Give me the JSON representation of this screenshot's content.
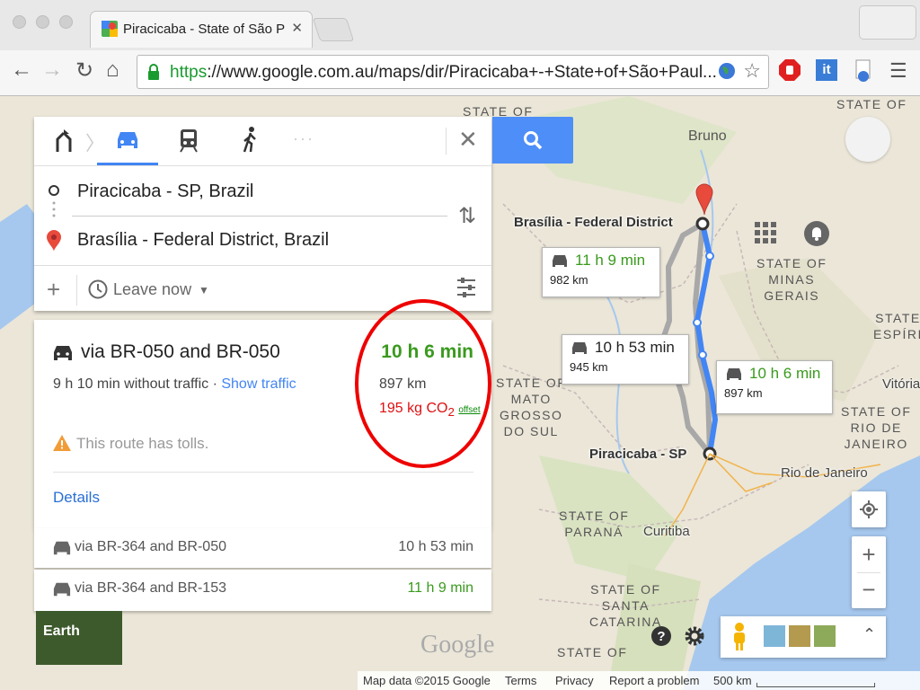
{
  "browser": {
    "tab_title": "Piracicaba - State of São P",
    "url_scheme": "https",
    "url_rest": "://www.google.com.au/maps/dir/Piracicaba+-+State+of+São+Paul..."
  },
  "directions": {
    "from": "Piracicaba - SP, Brazil",
    "to": "Brasília - Federal District, Brazil",
    "leave_label": "Leave now",
    "dots": "···"
  },
  "routes": {
    "selected": {
      "title": "via BR-050 and BR-050",
      "time": "10 h 6 min",
      "no_traffic": "9 h 10 min without traffic · ",
      "show_traffic": "Show traffic",
      "distance": "897 km",
      "co2_prefix": "195 kg CO",
      "co2_sub": "2",
      "offset": "offset",
      "tolls": "This route has tolls.",
      "details": "Details"
    },
    "alt1": {
      "title": "via BR-364 and BR-050",
      "time": "10 h 53 min"
    },
    "alt2": {
      "title": "via BR-364 and BR-153",
      "time": "11 h 9 min"
    }
  },
  "map": {
    "labels": {
      "state_of_top": "STATE OF",
      "bruno": "Bruno",
      "state_of_tr1": "STATE OF",
      "state_of_tr2": "ESPÍRI",
      "state_minas": "STATE OF\nMINAS\nGERAIS",
      "state_mato": "STATE OF\nMATO\nGROSSO\nDO SUL",
      "vitoria": "Vitória",
      "state_rio": "STATE OF\nRIO DE\nJANEIRO",
      "rio": "Rio de Janeiro",
      "state_parana": "STATE OF\nPARANÁ",
      "curitiba": "Curitiba",
      "state_sc": "STATE OF\nSANTA\nCATARINA",
      "state_bottom": "STATE OF",
      "brasilia": "Brasília - Federal District",
      "piracicaba": "Piracicaba - SP"
    },
    "callouts": [
      {
        "time": "11 h 9 min",
        "distance": "982 km"
      },
      {
        "time": "10 h 53 min",
        "distance": "945 km"
      },
      {
        "time": "10 h 6 min",
        "distance": "897 km"
      }
    ],
    "earth_label": "Earth",
    "google_logo": "Google"
  },
  "footer": {
    "map_data": "Map data ©2015 Google",
    "terms": "Terms",
    "privacy": "Privacy",
    "report": "Report a problem",
    "scale": "500 km"
  },
  "colors": {
    "route_selected": "#4285f4",
    "route_alt": "#9e9e9e",
    "time_green": "#3a9a1e",
    "co2_red": "#dd1111",
    "annotation_circle": "#e00000"
  }
}
